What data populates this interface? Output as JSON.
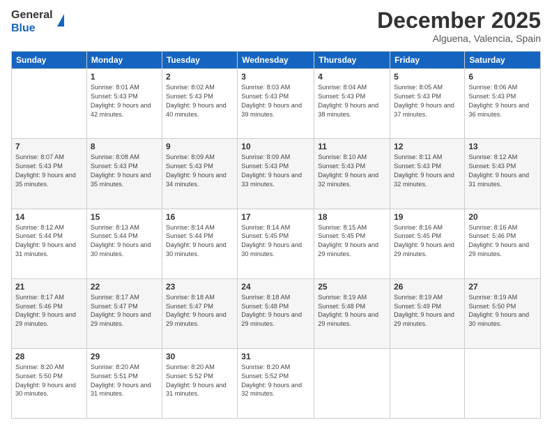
{
  "header": {
    "logo_line1": "General",
    "logo_line2": "Blue",
    "title": "December 2025",
    "subtitle": "Alguena, Valencia, Spain"
  },
  "days_of_week": [
    "Sunday",
    "Monday",
    "Tuesday",
    "Wednesday",
    "Thursday",
    "Friday",
    "Saturday"
  ],
  "weeks": [
    [
      {
        "day": "",
        "sunrise": "",
        "sunset": "",
        "daylight": ""
      },
      {
        "day": "1",
        "sunrise": "8:01 AM",
        "sunset": "5:43 PM",
        "daylight": "9 hours and 42 minutes."
      },
      {
        "day": "2",
        "sunrise": "8:02 AM",
        "sunset": "5:43 PM",
        "daylight": "9 hours and 40 minutes."
      },
      {
        "day": "3",
        "sunrise": "8:03 AM",
        "sunset": "5:43 PM",
        "daylight": "9 hours and 39 minutes."
      },
      {
        "day": "4",
        "sunrise": "8:04 AM",
        "sunset": "5:43 PM",
        "daylight": "9 hours and 38 minutes."
      },
      {
        "day": "5",
        "sunrise": "8:05 AM",
        "sunset": "5:43 PM",
        "daylight": "9 hours and 37 minutes."
      },
      {
        "day": "6",
        "sunrise": "8:06 AM",
        "sunset": "5:43 PM",
        "daylight": "9 hours and 36 minutes."
      }
    ],
    [
      {
        "day": "7",
        "sunrise": "8:07 AM",
        "sunset": "5:43 PM",
        "daylight": "9 hours and 35 minutes."
      },
      {
        "day": "8",
        "sunrise": "8:08 AM",
        "sunset": "5:43 PM",
        "daylight": "9 hours and 35 minutes."
      },
      {
        "day": "9",
        "sunrise": "8:09 AM",
        "sunset": "5:43 PM",
        "daylight": "9 hours and 34 minutes."
      },
      {
        "day": "10",
        "sunrise": "8:09 AM",
        "sunset": "5:43 PM",
        "daylight": "9 hours and 33 minutes."
      },
      {
        "day": "11",
        "sunrise": "8:10 AM",
        "sunset": "5:43 PM",
        "daylight": "9 hours and 32 minutes."
      },
      {
        "day": "12",
        "sunrise": "8:11 AM",
        "sunset": "5:43 PM",
        "daylight": "9 hours and 32 minutes."
      },
      {
        "day": "13",
        "sunrise": "8:12 AM",
        "sunset": "5:43 PM",
        "daylight": "9 hours and 31 minutes."
      }
    ],
    [
      {
        "day": "14",
        "sunrise": "8:12 AM",
        "sunset": "5:44 PM",
        "daylight": "9 hours and 31 minutes."
      },
      {
        "day": "15",
        "sunrise": "8:13 AM",
        "sunset": "5:44 PM",
        "daylight": "9 hours and 30 minutes."
      },
      {
        "day": "16",
        "sunrise": "8:14 AM",
        "sunset": "5:44 PM",
        "daylight": "9 hours and 30 minutes."
      },
      {
        "day": "17",
        "sunrise": "8:14 AM",
        "sunset": "5:45 PM",
        "daylight": "9 hours and 30 minutes."
      },
      {
        "day": "18",
        "sunrise": "8:15 AM",
        "sunset": "5:45 PM",
        "daylight": "9 hours and 29 minutes."
      },
      {
        "day": "19",
        "sunrise": "8:16 AM",
        "sunset": "5:45 PM",
        "daylight": "9 hours and 29 minutes."
      },
      {
        "day": "20",
        "sunrise": "8:16 AM",
        "sunset": "5:46 PM",
        "daylight": "9 hours and 29 minutes."
      }
    ],
    [
      {
        "day": "21",
        "sunrise": "8:17 AM",
        "sunset": "5:46 PM",
        "daylight": "9 hours and 29 minutes."
      },
      {
        "day": "22",
        "sunrise": "8:17 AM",
        "sunset": "5:47 PM",
        "daylight": "9 hours and 29 minutes."
      },
      {
        "day": "23",
        "sunrise": "8:18 AM",
        "sunset": "5:47 PM",
        "daylight": "9 hours and 29 minutes."
      },
      {
        "day": "24",
        "sunrise": "8:18 AM",
        "sunset": "5:48 PM",
        "daylight": "9 hours and 29 minutes."
      },
      {
        "day": "25",
        "sunrise": "8:19 AM",
        "sunset": "5:48 PM",
        "daylight": "9 hours and 29 minutes."
      },
      {
        "day": "26",
        "sunrise": "8:19 AM",
        "sunset": "5:49 PM",
        "daylight": "9 hours and 29 minutes."
      },
      {
        "day": "27",
        "sunrise": "8:19 AM",
        "sunset": "5:50 PM",
        "daylight": "9 hours and 30 minutes."
      }
    ],
    [
      {
        "day": "28",
        "sunrise": "8:20 AM",
        "sunset": "5:50 PM",
        "daylight": "9 hours and 30 minutes."
      },
      {
        "day": "29",
        "sunrise": "8:20 AM",
        "sunset": "5:51 PM",
        "daylight": "9 hours and 31 minutes."
      },
      {
        "day": "30",
        "sunrise": "8:20 AM",
        "sunset": "5:52 PM",
        "daylight": "9 hours and 31 minutes."
      },
      {
        "day": "31",
        "sunrise": "8:20 AM",
        "sunset": "5:52 PM",
        "daylight": "9 hours and 32 minutes."
      },
      {
        "day": "",
        "sunrise": "",
        "sunset": "",
        "daylight": ""
      },
      {
        "day": "",
        "sunrise": "",
        "sunset": "",
        "daylight": ""
      },
      {
        "day": "",
        "sunrise": "",
        "sunset": "",
        "daylight": ""
      }
    ]
  ]
}
